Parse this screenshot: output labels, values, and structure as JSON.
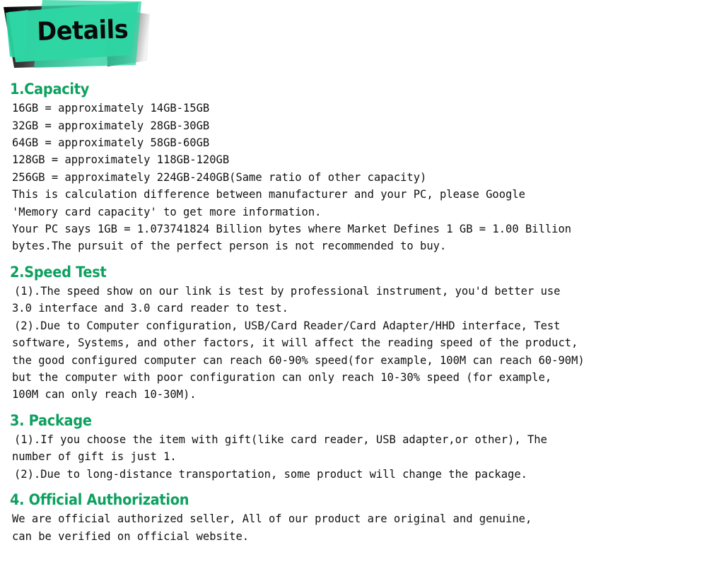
{
  "banner": {
    "title": "Details",
    "teal_color": "#2ED6A4",
    "shadow_dark": "#0d0d0d",
    "shadow_light": "#d6d6d6"
  },
  "theme": {
    "heading_green": "#0DA05F",
    "body_text": "#111111",
    "background": "#FFFFFF"
  },
  "sections": [
    {
      "heading": "1.Capacity",
      "lines": [
        "16GB = approximately 14GB-15GB",
        "32GB = approximately 28GB-30GB",
        "64GB = approximately 58GB-60GB",
        "128GB = approximately 118GB-120GB",
        "256GB = approximately 224GB-240GB(Same ratio of other capacity)",
        "This is calculation difference between manufacturer and your PC, please Google",
        "'Memory card capacity' to get more information.",
        "Your PC says 1GB = 1.073741824 Billion bytes where Market Defines 1 GB = 1.00 Billion",
        "bytes.The pursuit of the perfect person is not recommended to buy."
      ]
    },
    {
      "heading": "2.Speed Test",
      "lines": [
        "(1).The speed show on our link is test by professional instrument, you'd better use",
        "3.0 interface and 3.0 card reader to test.",
        "(2).Due to Computer configuration, USB/Card Reader/Card Adapter/HHD interface, Test",
        "software, Systems, and other factors, it will affect the reading speed of the product,",
        "the good configured computer can reach 60-90% speed(for example, 100M can reach 60-90M)",
        "but the computer with poor configuration can only reach 10-30% speed (for example,",
        "100M can only reach 10-30M)."
      ]
    },
    {
      "heading": "3. Package",
      "lines": [
        "(1).If you choose the item with gift(like card reader, USB adapter,or other), The",
        "number of gift is just 1.",
        "(2).Due to long-distance transportation, some product will change the package."
      ]
    },
    {
      "heading": "4. Official Authorization",
      "lines": [
        "We are official authorized seller, All of our product are original and genuine,",
        "can be verified on official website."
      ]
    }
  ]
}
